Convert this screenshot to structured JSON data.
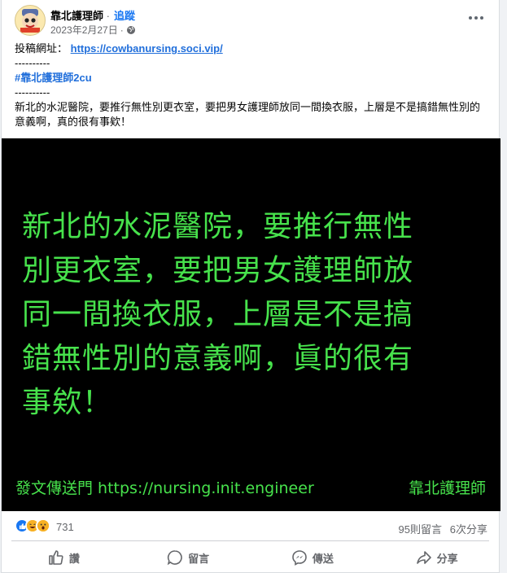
{
  "post": {
    "page_name": "靠北護理師",
    "separator": "·",
    "follow_label": "追蹤",
    "date": "2023年2月27日",
    "date_sep": "·",
    "privacy_icon": "globe-icon",
    "submit_label": "投稿網址：",
    "submit_url": "https://cowbanursing.soci.vip/",
    "dashes_1": "----------",
    "hashtag": "#靠北護理師2cu",
    "dashes_2": "----------",
    "content": "新北的水泥醫院，要推行無性別更衣室，要把男女護理師放同一間換衣服，上層是不是搞錯無性別的意義啊，真的很有事欸！"
  },
  "image": {
    "lines": [
      "新北的水泥醫院，要推行無性",
      "別更衣室，要把男女護理師放",
      "同一間換衣服，上層是不是搞",
      "錯無性別的意義啊，眞的很有",
      "事欸！"
    ],
    "footer_left": "發文傳送門 https://nursing.init.engineer",
    "footer_right": "靠北護理師",
    "text_color": "#47e24c"
  },
  "stats": {
    "reactions": [
      "like-icon",
      "haha-icon",
      "wow-icon"
    ],
    "reaction_count": "731",
    "comments": "95則留言",
    "shares": "6次分享"
  },
  "actions": {
    "like": "讚",
    "comment": "留言",
    "send": "傳送",
    "share": "分享"
  }
}
